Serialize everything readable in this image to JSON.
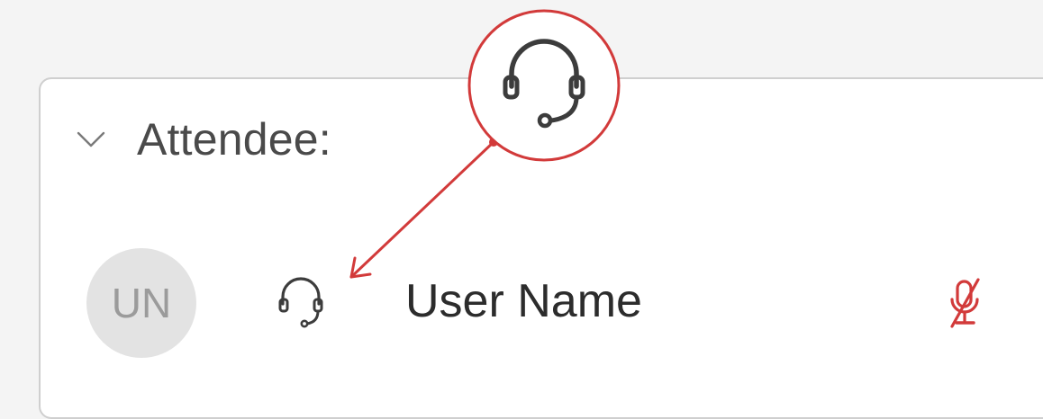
{
  "section": {
    "label": "Attendee:",
    "chevron_icon": "chevron-down-icon"
  },
  "attendee": {
    "initials": "UN",
    "name": "User Name",
    "status_icon": "headset-icon",
    "mic_icon": "mic-muted-icon"
  },
  "callout": {
    "icon": "headset-icon",
    "color": "#d23a3a"
  },
  "colors": {
    "background": "#f4f4f4",
    "panel_border": "#cfcfcf",
    "muted": "#d23a3a"
  }
}
